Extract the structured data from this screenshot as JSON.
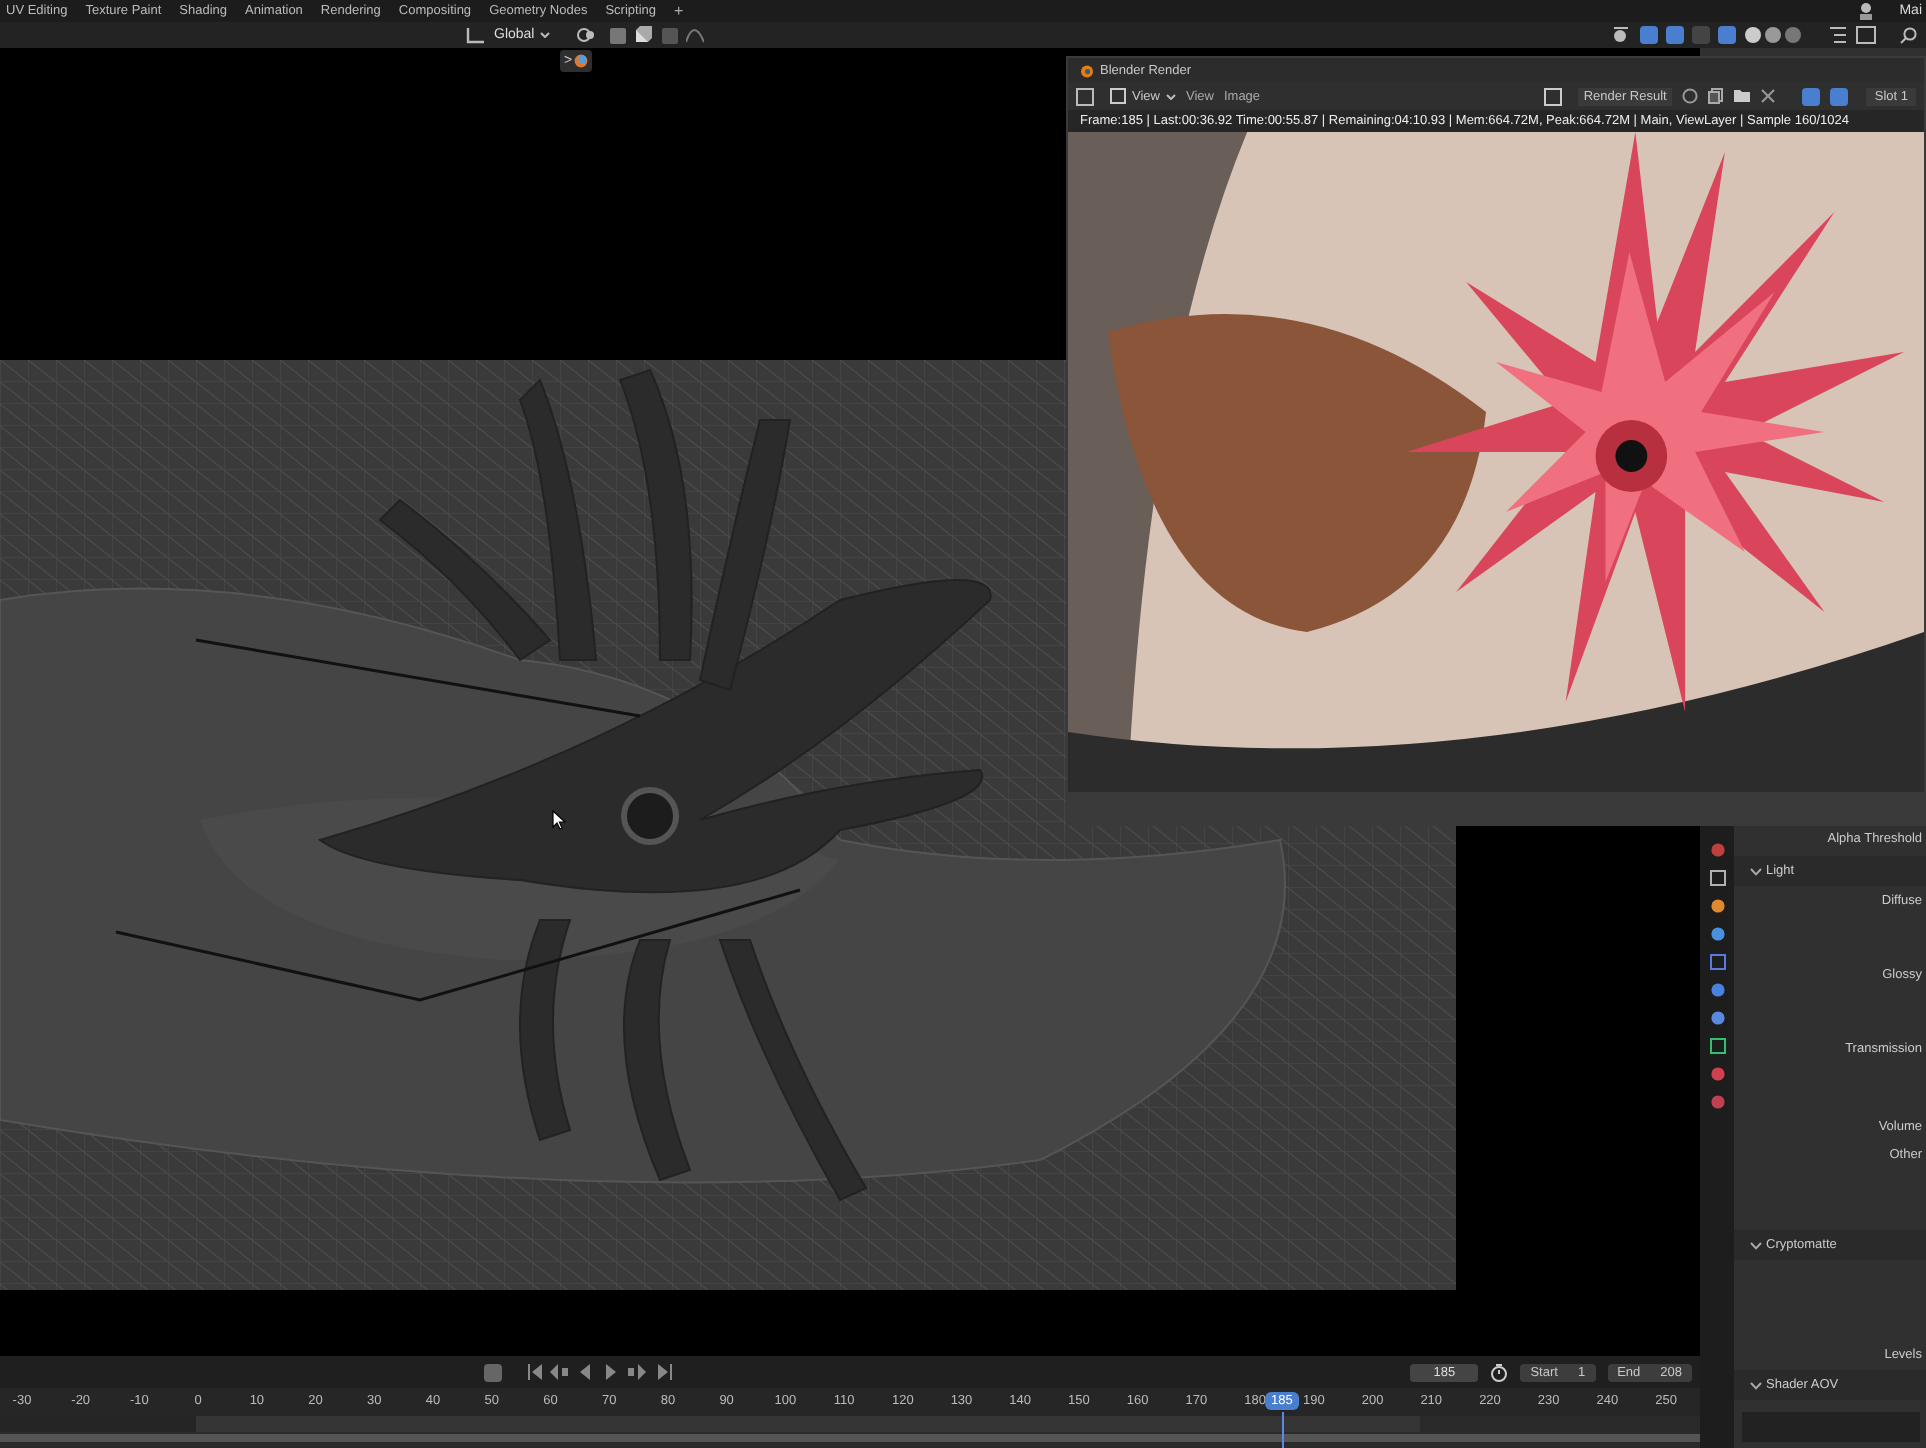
{
  "workspace_tabs": [
    "UV Editing",
    "Texture Paint",
    "Shading",
    "Animation",
    "Rendering",
    "Compositing",
    "Geometry Nodes",
    "Scripting"
  ],
  "add_tab": "+",
  "scene_label": "Mai",
  "viewport_header": {
    "orientation": "Global",
    "expand_arrow": ">"
  },
  "render_window": {
    "title": "Blender Render",
    "view_dropdown": "View",
    "menus": [
      "View",
      "Image"
    ],
    "image_name": "Render Result",
    "slot": "Slot 1",
    "status": "Frame:185 | Last:00:36.92 Time:00:55.87 | Remaining:04:10.93 | Mem:664.72M, Peak:664.72M | Main, ViewLayer | Sample 160/1024"
  },
  "properties": {
    "rows": [
      {
        "kind": "field",
        "text": "Alpha Threshold"
      },
      {
        "kind": "section",
        "text": "Light",
        "expanded": true
      },
      {
        "kind": "group",
        "text": "Diffuse"
      },
      {
        "kind": "group",
        "text": "Glossy"
      },
      {
        "kind": "group",
        "text": "Transmission"
      },
      {
        "kind": "field",
        "text": "Volume"
      },
      {
        "kind": "tall",
        "text": "Other"
      },
      {
        "kind": "section",
        "text": "Cryptomatte",
        "expanded": true
      },
      {
        "kind": "stack",
        "text": "Levels"
      },
      {
        "kind": "section",
        "text": "Shader AOV",
        "expanded": true
      }
    ]
  },
  "timeline": {
    "current_frame": "185",
    "start_label": "Start",
    "start": "1",
    "end_label": "End",
    "end": "208",
    "ticks": [
      "-30",
      "-20",
      "-10",
      "0",
      "10",
      "20",
      "30",
      "40",
      "50",
      "60",
      "70",
      "80",
      "90",
      "100",
      "110",
      "120",
      "130",
      "140",
      "150",
      "160",
      "170",
      "180",
      "190",
      "200",
      "210",
      "220",
      "230",
      "240",
      "250"
    ],
    "playhead": {
      "label": "185",
      "level": 0.754
    }
  }
}
